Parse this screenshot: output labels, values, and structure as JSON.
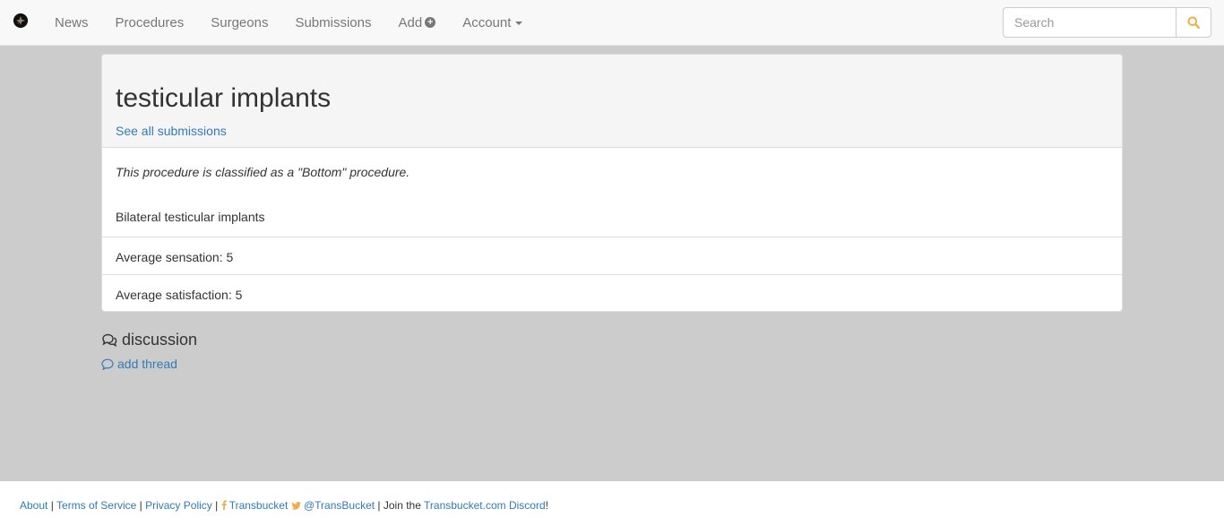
{
  "nav": {
    "items": [
      {
        "label": "News"
      },
      {
        "label": "Procedures"
      },
      {
        "label": "Surgeons"
      },
      {
        "label": "Submissions"
      },
      {
        "label": "Add"
      },
      {
        "label": "Account"
      }
    ],
    "search_placeholder": "Search",
    "search_icon": "search-icon",
    "accent_color": "#f0ad4e"
  },
  "panel": {
    "title": "testicular implants",
    "see_all_label": "See all submissions",
    "classification": "This procedure is classified as a \"Bottom\" procedure.",
    "description": "Bilateral testicular implants",
    "stats": [
      {
        "label": "Average sensation: 5"
      },
      {
        "label": "Average satisfaction: 5"
      }
    ]
  },
  "discussion": {
    "title": "discussion",
    "add_thread_label": "add thread"
  },
  "footer": {
    "about": "About",
    "sep1": " | ",
    "terms": "Terms of Service",
    "sep2": " | ",
    "privacy": "Privacy Policy",
    "sep3": " | ",
    "facebook": "Transbucket",
    "twitter": "@TransBucket",
    "join_text": " | Join the ",
    "discord": "Transbucket.com Discord",
    "bang": "!"
  }
}
